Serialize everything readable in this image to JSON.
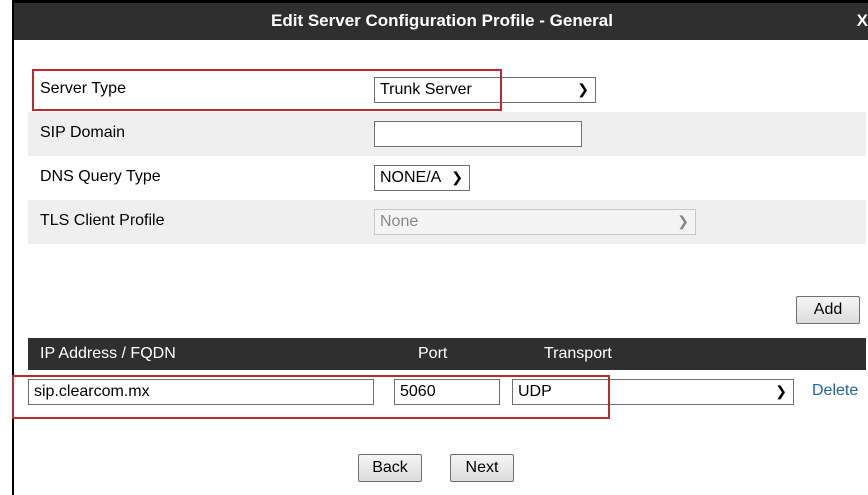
{
  "dialog": {
    "title": "Edit Server Configuration Profile - General",
    "close_label": "X"
  },
  "fields": {
    "server_type": {
      "label": "Server Type",
      "value": "Trunk Server"
    },
    "sip_domain": {
      "label": "SIP Domain",
      "value": ""
    },
    "dns_query_type": {
      "label": "DNS Query Type",
      "value": "NONE/A"
    },
    "tls_client_profile": {
      "label": "TLS Client Profile",
      "value": "None"
    }
  },
  "add_label": "Add",
  "table": {
    "headers": {
      "address": "IP Address / FQDN",
      "port": "Port",
      "transport": "Transport"
    },
    "row": {
      "address": "sip.clearcom.mx",
      "port": "5060",
      "transport": "UDP",
      "delete_label": "Delete"
    }
  },
  "footer": {
    "back_label": "Back",
    "next_label": "Next"
  },
  "colors": {
    "titlebar": "#2f2f2f",
    "highlight": "#c0282e",
    "link": "#1f62a8"
  }
}
